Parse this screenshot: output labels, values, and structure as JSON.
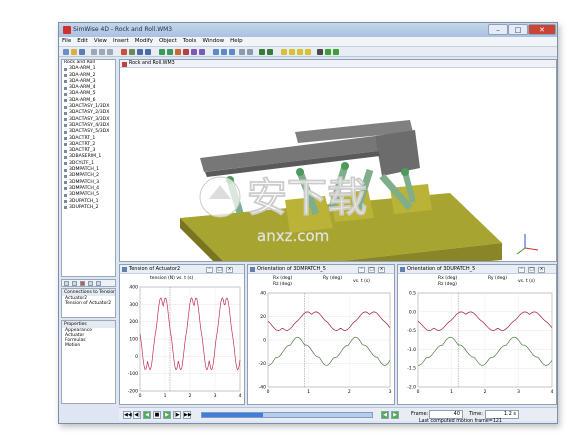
{
  "window": {
    "title": "SimWise 4D - Rock and Roll.WM3",
    "controls": {
      "minimize": "–",
      "maximize": "□",
      "close": "✕"
    }
  },
  "menu": [
    "File",
    "Edit",
    "View",
    "Insert",
    "Modify",
    "Object",
    "Tools",
    "Window",
    "Help"
  ],
  "tree": {
    "root": "Rock and Roll",
    "items": [
      "3DA-ARM_1",
      "3DA-ARM_2",
      "3DA-ARM_3",
      "3DA-ARM_4",
      "3DA-ARM_5",
      "3DA-ARM_6",
      "3DACTASY_1/3DX",
      "3DACTASY_2/3DX",
      "3DACTASY_3/3DX",
      "3DACTASY_4/3DX",
      "3DACTASY_5/3DX",
      "3DACTRT_1",
      "3DACTRT_2",
      "3DACTRT_3",
      "3DBASERIM_1",
      "3DCYLTF_1",
      "3DMPATCH_1",
      "3DMPATCH_2",
      "3DMPATCH_3",
      "3DMPATCH_4",
      "3DMPATCH_5",
      "3DUPATCH_1",
      "3DUPATCH_2"
    ]
  },
  "connections": {
    "header": "Connections to Tension ...",
    "items": [
      "Actuator2",
      "Tension of Actuator2"
    ]
  },
  "properties": {
    "header": "Properties",
    "items": [
      "Appearance",
      "Actuator",
      "Formulas",
      "Motion"
    ]
  },
  "view3d": {
    "title": "Rock and Roll.WM3"
  },
  "plots": [
    {
      "title": "Tension of Actuator2",
      "legend": [
        "tension (N) vs. t (s)"
      ],
      "color": "#c0304a",
      "yticks": [
        "400",
        "300",
        "200",
        "100",
        "0",
        "-100",
        "-200"
      ],
      "xticks": [
        "0",
        "1",
        "2",
        "3",
        "4"
      ]
    },
    {
      "title": "Orientation of 3DMPATCH_5",
      "legend": [
        "Rx (deg)",
        "Rz (deg)",
        "Ry (deg)",
        "vs. t (s)"
      ],
      "color": "#a01830",
      "yticks": [
        "40",
        "20",
        "0",
        "-20",
        "-40"
      ],
      "xticks": [
        "0",
        "1",
        "2",
        "3"
      ]
    },
    {
      "title": "Orientation of 3DUPATCH_5",
      "legend": [
        "Rx (deg)",
        "Rz (deg)",
        "Ry (deg)",
        "vs. t (s)"
      ],
      "color": "#a01830",
      "yticks": [
        "0.5",
        "0.0",
        "-0.5",
        "-1.0",
        "-1.5",
        "-2.0"
      ],
      "xticks": [
        "0",
        "1",
        "2",
        "3",
        "4"
      ]
    }
  ],
  "playback": {
    "frame_label": "Frame:",
    "frame_value": "40",
    "time_label": "Time:",
    "time_value": "1.2 s",
    "progress": 0.36
  },
  "status": "Last computed motion frame=121",
  "watermark": {
    "text": "安下载",
    "url": "anxz.com"
  },
  "colors": {
    "accent": "#3f7fd8",
    "titlebar": "#a9c1e0",
    "plot_line": "#c0304a",
    "model_base": "#a8a430",
    "model_bar": "#777777",
    "model_actuator": "#7fae8a"
  }
}
